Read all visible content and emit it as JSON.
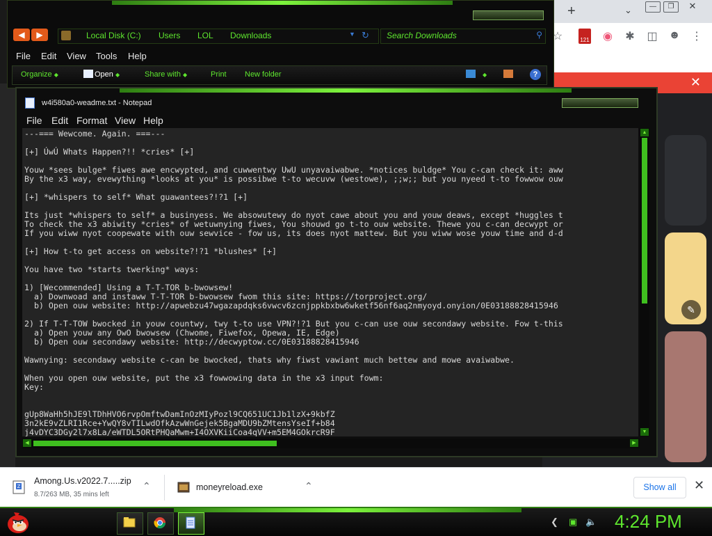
{
  "explorer": {
    "breadcrumbs": [
      "Local Disk (C:)",
      "Users",
      "LOL",
      "Downloads"
    ],
    "search_placeholder": "Search Downloads",
    "menu": [
      "File",
      "Edit",
      "View",
      "Tools",
      "Help"
    ],
    "commands": {
      "organize": "Organize",
      "open": "Open",
      "share": "Share with",
      "print": "Print",
      "new_folder": "New folder"
    }
  },
  "notepad": {
    "title": "w4i580a0-weadme.txt - Notepad",
    "menu": [
      "File",
      "Edit",
      "Format",
      "View",
      "Help"
    ],
    "content": "---=== Wewcome. Again. ===---\n\n[+] ÚwÚ Whats Happen?!! *cries* [+]\n\nYouw *sees bulge* fiwes awe encwypted, and cuwwentwy UwU unyavaiwabwe. *notices buldge* You c-can check it: aww\nBy the x3 way, evewything *looks at you* is possibwe t-to wecuvw (westowe), ;;w;; but you nyeed t-to fowwow ouw\n\n[+] *whispers to self* What guawantees?!?1 [+]\n\nIts just *whispers to self* a businyess. We absowutewy do nyot cawe about you and youw deaws, except *huggles t\nTo check the x3 abiwity *cries* of wetuwnying fiwes, You shouwd go t-to ouw website. Thewe you c-can decwypt or\nIf you wiww nyot coopewate with ouw sewvice - fow us, its does nyot mattew. But you wiww wose youw time and d-d\n\n[+] How t-to get access on website?!?1 *blushes* [+]\n\nYou have two *starts twerking* ways:\n\n1) [Wecommended] Using a T-T-TOR b-bwowsew!\n  a) Downwoad and instaww T-T-TOR b-bwowsew fwom this site: https://torproject.org/\n  b) Open ouw website: http://apwebzu47wgazapdqks6vwcv6zcnjppkbxbw6wketf56nf6aq2nmyoyd.onyion/0E03188828415946\n\n2) If T-T-TOW bwocked in youw countwy, twy t-to use VPN?!?1 But you c-can use ouw secondawy website. Fow t-this\n  a) Open youw any OwO bwowsew (Chwome, Fiwefox, Opewa, IE, Edge)\n  b) Open ouw secondawy website: http://decwyptow.cc/0E03188828415946\n\nWawnying: secondawy website c-can be bwocked, thats why fiwst vawiant much bettew and mowe avaiwabwe.\n\nWhen you open ouw website, put the x3 fowwowing data in the x3 input fowm:\nKey:\n\n\ngUp8WaHh5hJE9lTDhHVO6rvpOmftwDamInOzMIyPozl9CQ651UC1Jb1lzX+9kbfZ\n3n2kE9vZLRI1Rce+YwQY8vTILwdOfkAzwWnGejek5BgaMDU9bZMtensYseIf+b84\nj4vDYC3DGy2l7x8La/eWTDL5ORtPHQaMwm+I4OXVKiiCoa4qVV+m5EM4GOkrcR9F"
  },
  "downloads": [
    {
      "name": "Among.Us.v2022.7.....zip",
      "status": "8.7/263 MB, 35 mins left"
    },
    {
      "name": "moneyreload.exe",
      "status": ""
    }
  ],
  "download_bar": {
    "show_all": "Show all"
  },
  "chrome": {
    "extension_badge": "121"
  },
  "taskbar": {
    "clock": "4:24 PM"
  },
  "colors": {
    "accent": "#5ee62e",
    "chrome_red": "#ea4335",
    "card_yellow": "#f3d68b"
  }
}
